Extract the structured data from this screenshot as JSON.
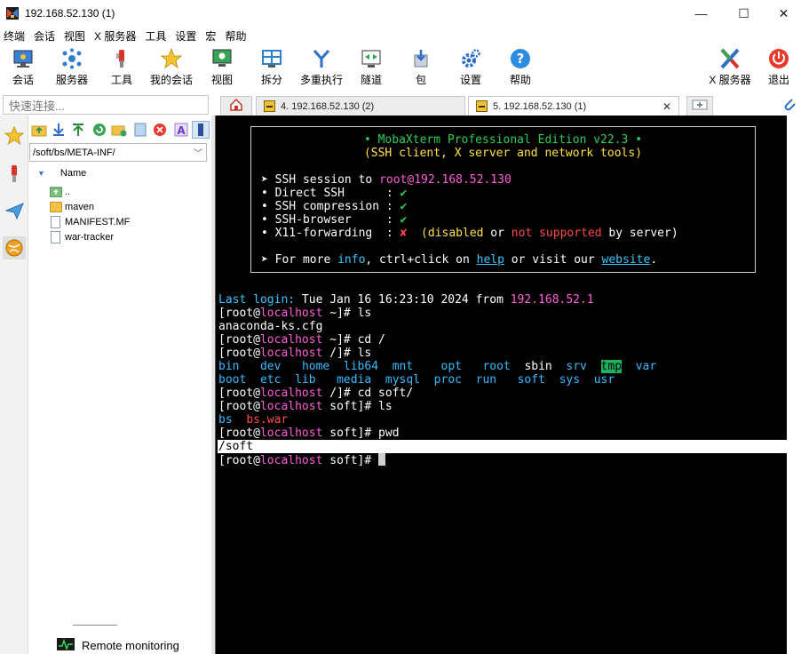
{
  "window": {
    "title": "192.168.52.130 (1)"
  },
  "menu": [
    "终端",
    "会话",
    "视图",
    "X 服务器",
    "工具",
    "设置",
    "宏",
    "帮助"
  ],
  "toolbar": {
    "items": [
      "会话",
      "服务器",
      "工具",
      "我的会话",
      "视图",
      "拆分",
      "多重执行",
      "隧道",
      "包",
      "设置",
      "帮助"
    ],
    "xserver": "X 服务器",
    "exit": "退出"
  },
  "quick_connect": {
    "placeholder": "快速连接..."
  },
  "tabs": [
    {
      "label": "4. 192.168.52.130 (2)"
    },
    {
      "label": "5. 192.168.52.130 (1)",
      "active": true
    }
  ],
  "browser": {
    "path": "/soft/bs/META-INF/",
    "column": "Name",
    "entries": [
      {
        "name": "..",
        "kind": "up"
      },
      {
        "name": "maven",
        "kind": "folder"
      },
      {
        "name": "MANIFEST.MF",
        "kind": "file"
      },
      {
        "name": "war-tracker",
        "kind": "file"
      }
    ],
    "remote_monitoring": "Remote monitoring"
  },
  "terminal": {
    "banner": {
      "title": "• MobaXterm Professional Edition v22.3 •",
      "subtitle": "(SSH client, X server and network tools)",
      "ssh_prefix": "➤ SSH session to ",
      "ssh_host": "root@192.168.52.130",
      "rows": [
        {
          "name": "• Direct SSH      :",
          "status": "✔"
        },
        {
          "name": "• SSH compression :",
          "status": "✔"
        },
        {
          "name": "• SSH-browser     :",
          "status": "✔"
        },
        {
          "name": "• X11-forwarding  :",
          "status": "✘"
        }
      ],
      "x11_note": [
        "(",
        "disabled",
        " or ",
        "not supported",
        " by server)"
      ],
      "more": [
        "➤ For more ",
        "info",
        ", ctrl+click on ",
        "help",
        " or visit our ",
        "website",
        "."
      ]
    },
    "last_login": [
      "Last login:",
      " Tue Jan 16 16:23:10 2024 from ",
      "192.168.52.1"
    ],
    "prompt": {
      "open": "[root@",
      "host": "localhost",
      "root_dir": " ~]# ",
      "slash_dir": " /]# ",
      "soft_dir": " soft]# "
    },
    "commands": [
      "ls",
      "cd /",
      "ls",
      "cd soft/",
      "ls",
      "pwd"
    ],
    "home_ls": "anaconda-ks.cfg",
    "root_ls_row1": [
      "bin",
      "dev",
      "home",
      "lib64",
      "mnt",
      "opt",
      "root",
      "sbin",
      "srv",
      "tmp",
      "var"
    ],
    "root_ls_row2": [
      "boot",
      "etc",
      "lib",
      "media",
      "mysql",
      "proc",
      "run",
      "soft",
      "sys",
      "usr"
    ],
    "soft_ls": [
      "bs",
      "bs.war"
    ],
    "pwd_output": "/soft"
  }
}
